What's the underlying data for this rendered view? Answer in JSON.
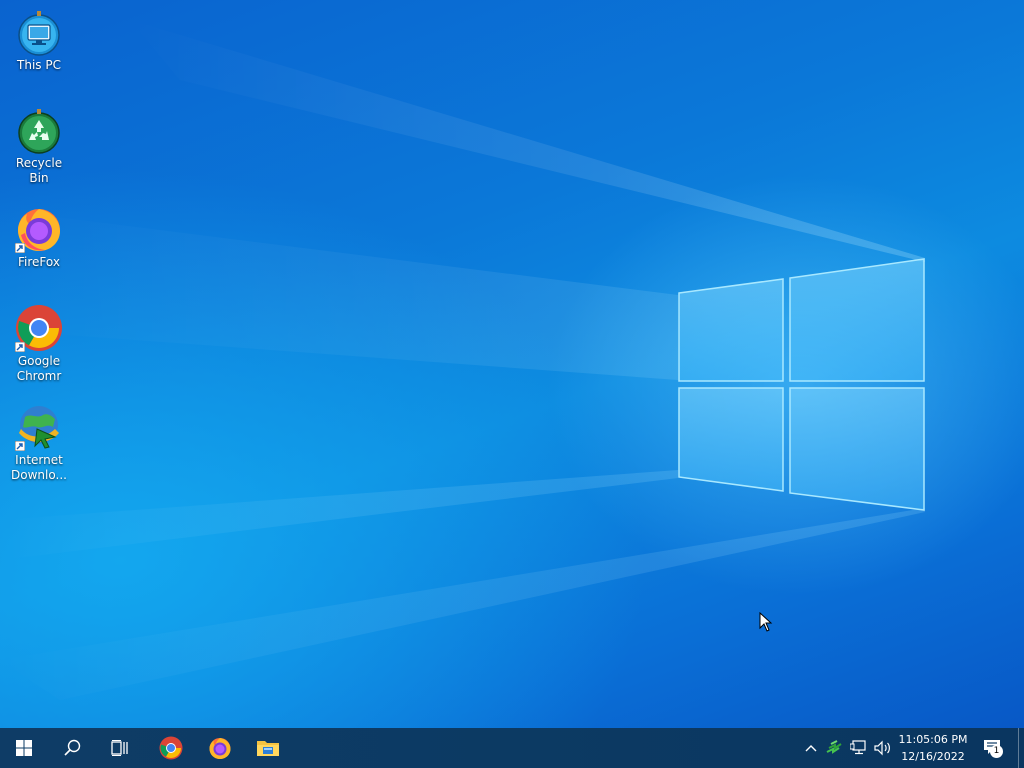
{
  "desktop": {
    "icons": [
      {
        "label": "This PC",
        "icon": "this-pc-icon"
      },
      {
        "label": "Recycle Bin",
        "icon": "recycle-bin-icon"
      },
      {
        "label": "FireFox",
        "icon": "firefox-icon"
      },
      {
        "label": "Google Chromr",
        "icon": "chrome-icon"
      },
      {
        "label": "Internet Downlo...",
        "icon": "internet-download-manager-icon"
      }
    ]
  },
  "taskbar": {
    "start": "windows-start-icon",
    "search": "search-icon",
    "task_view": "task-view-icon",
    "pinned": [
      {
        "name": "Google Chrome",
        "icon": "chrome-icon"
      },
      {
        "name": "Firefox",
        "icon": "firefox-icon"
      },
      {
        "name": "File Explorer",
        "icon": "file-explorer-icon"
      }
    ],
    "tray": {
      "icons": [
        "chevron-up-icon",
        "idm-tray-icon",
        "network-icon",
        "volume-icon"
      ],
      "time": "11:05:06 PM",
      "date": "12/16/2022",
      "notification_count": "1"
    }
  },
  "colors": {
    "desktop_blue": "#0b78d8",
    "taskbar": "#0c3a63",
    "text": "#ffffff"
  }
}
